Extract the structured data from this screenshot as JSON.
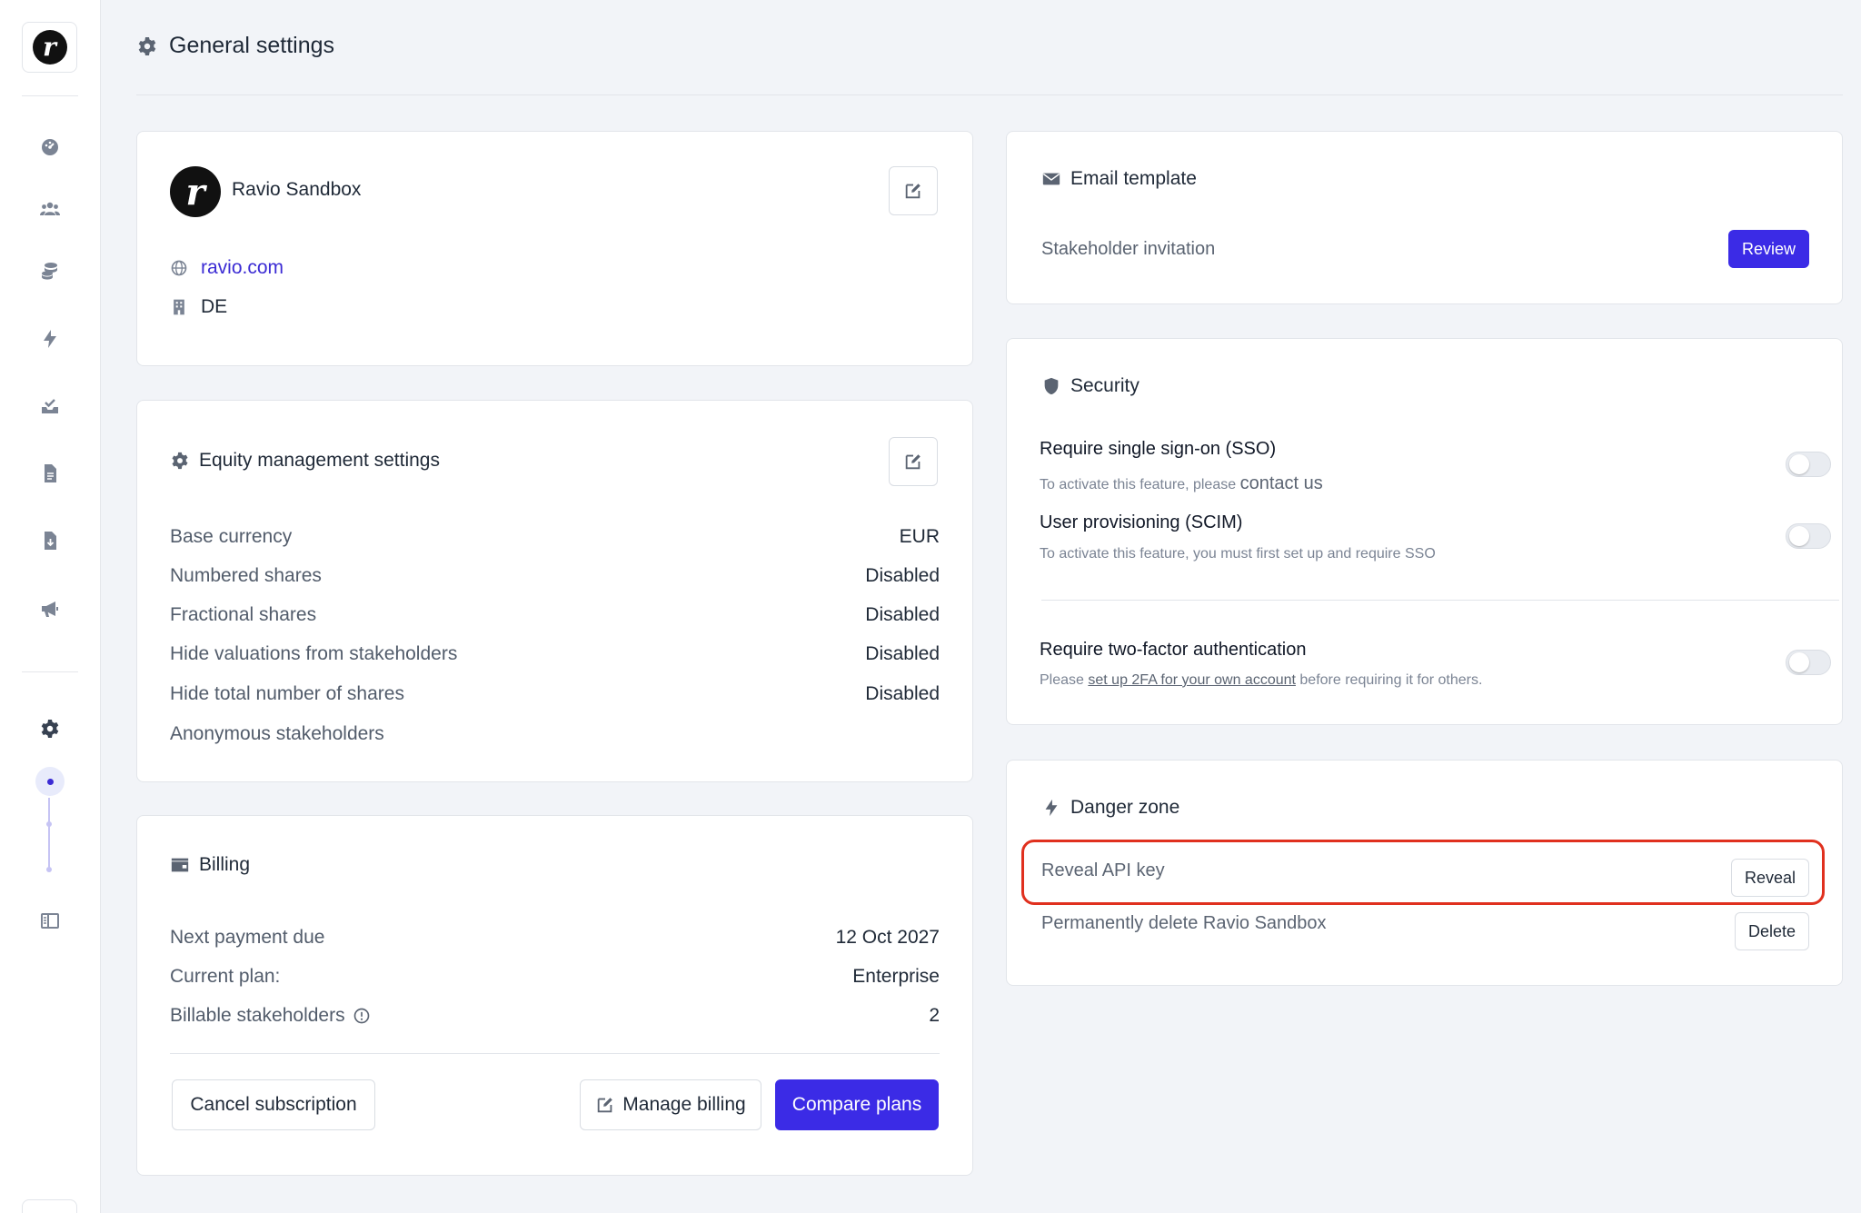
{
  "sidebar": {
    "logo_letter": "r",
    "items": [
      {
        "icon": "dashboard-icon"
      },
      {
        "icon": "stakeholders-icon"
      },
      {
        "icon": "equity-icon"
      },
      {
        "icon": "lightning-icon"
      },
      {
        "icon": "inbox-check-icon"
      },
      {
        "icon": "document-icon"
      },
      {
        "icon": "document-download-icon"
      },
      {
        "icon": "megaphone-icon"
      },
      {
        "icon": "gear-icon"
      },
      {
        "icon": "layout-icon"
      }
    ]
  },
  "header": {
    "title": "General settings"
  },
  "org_card": {
    "avatar_letter": "r",
    "name": "Ravio Sandbox",
    "website": "ravio.com",
    "country": "DE"
  },
  "equity_card": {
    "title": "Equity management settings",
    "rows": [
      {
        "label": "Base currency",
        "value": "EUR"
      },
      {
        "label": "Numbered shares",
        "value": "Disabled"
      },
      {
        "label": "Fractional shares",
        "value": "Disabled"
      },
      {
        "label": "Hide valuations from stakeholders",
        "value": "Disabled"
      },
      {
        "label": "Hide total number of shares",
        "value": "Disabled"
      },
      {
        "label": "Anonymous stakeholders",
        "value": ""
      }
    ]
  },
  "billing_card": {
    "title": "Billing",
    "rows": [
      {
        "label": "Next payment due",
        "value": "12 Oct 2027"
      },
      {
        "label": "Current plan:",
        "value": "Enterprise"
      },
      {
        "label": "Billable stakeholders",
        "value": "2"
      }
    ],
    "cancel_label": "Cancel subscription",
    "manage_label": "Manage billing",
    "compare_label": "Compare plans"
  },
  "email_card": {
    "title": "Email template",
    "item_label": "Stakeholder invitation",
    "review_label": "Review"
  },
  "security_card": {
    "title": "Security",
    "sso_title": "Require single sign-on (SSO)",
    "sso_sub_prefix": "To activate this feature, please",
    "sso_sub_link": "contact us",
    "scim_title": "User provisioning (SCIM)",
    "scim_sub": "To activate this feature, you must first set up and require SSO",
    "tfa_title": "Require two-factor authentication",
    "tfa_sub_prefix": "Please",
    "tfa_sub_link": "set up 2FA for your own account",
    "tfa_sub_suffix": "before requiring it for others."
  },
  "danger_card": {
    "title": "Danger zone",
    "reveal_text": "Reveal API key",
    "reveal_label": "Reveal",
    "delete_text": "Permanently delete Ravio Sandbox",
    "delete_label": "Delete"
  },
  "colors": {
    "accent": "#3b2be6",
    "highlight": "#e0301e",
    "background": "#f2f4f8"
  }
}
